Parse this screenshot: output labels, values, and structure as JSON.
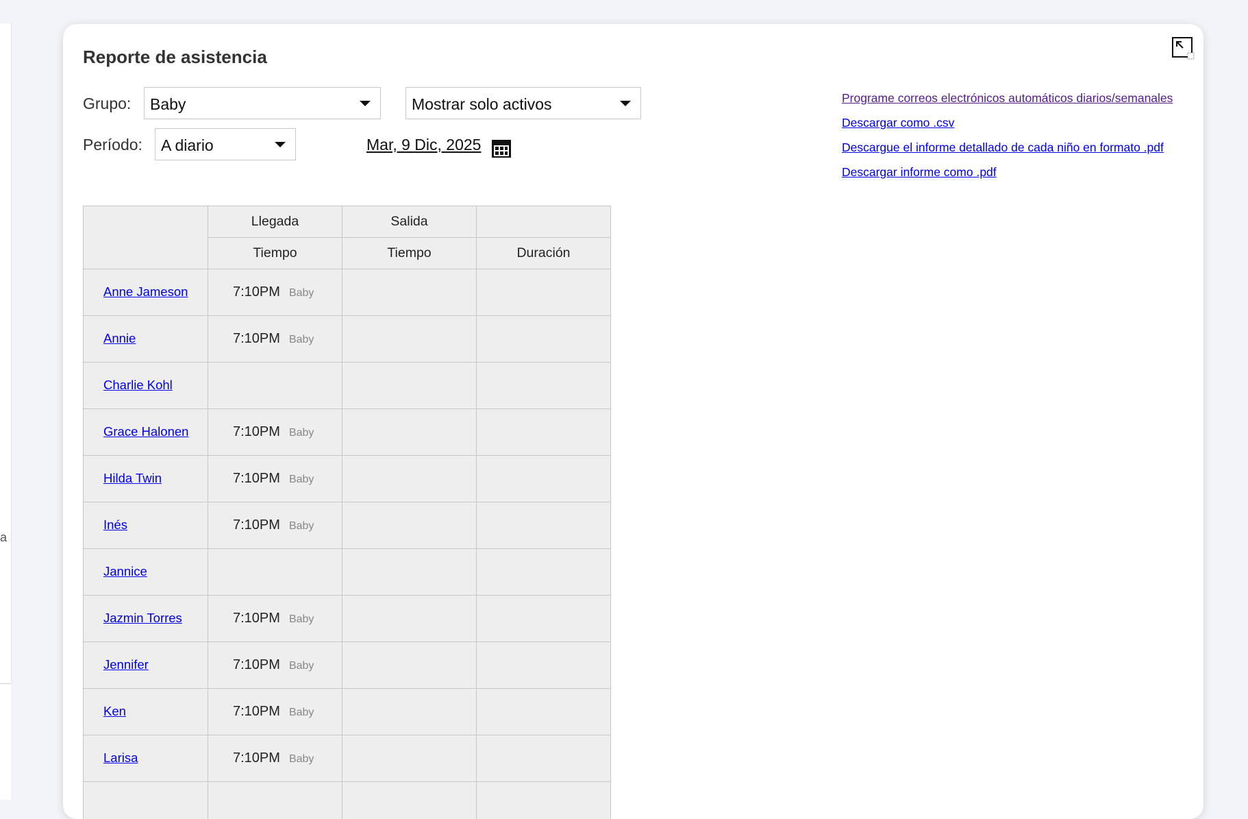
{
  "background": {
    "partial_text": "a"
  },
  "dialog": {
    "title": "Reporte de asistencia",
    "expand_icon": "expand-icon"
  },
  "filters": {
    "group_label": "Grupo:",
    "group_value": "Baby",
    "status_value": "Mostrar solo activos",
    "period_label": "Período:",
    "period_value": "A diario",
    "date": "Mar, 9 Dic, 2025",
    "calendar_icon": "calendar-icon"
  },
  "links": {
    "schedule_emails": "Programe correos electrónicos automáticos diarios/semanales",
    "download_csv": "Descargar como .csv",
    "download_detailed_pdf": "Descargue el informe detallado de cada niño en formato .pdf",
    "download_pdf": "Descargar informe como .pdf"
  },
  "table": {
    "arrival_header": "Llegada",
    "departure_header": "Salida",
    "time_header": "Tiempo",
    "duration_header": "Duración",
    "rows": [
      {
        "name": "Anne Jameson",
        "arrival_time": "7:10PM",
        "arrival_group": "Baby"
      },
      {
        "name": "Annie",
        "arrival_time": "7:10PM",
        "arrival_group": "Baby"
      },
      {
        "name": "Charlie Kohl",
        "arrival_time": "",
        "arrival_group": ""
      },
      {
        "name": "Grace Halonen",
        "arrival_time": "7:10PM",
        "arrival_group": "Baby"
      },
      {
        "name": "Hilda Twin",
        "arrival_time": "7:10PM",
        "arrival_group": "Baby"
      },
      {
        "name": "Inés",
        "arrival_time": "7:10PM",
        "arrival_group": "Baby"
      },
      {
        "name": "Jannice",
        "arrival_time": "",
        "arrival_group": ""
      },
      {
        "name": "Jazmin Torres",
        "arrival_time": "7:10PM",
        "arrival_group": "Baby"
      },
      {
        "name": "Jennifer",
        "arrival_time": "7:10PM",
        "arrival_group": "Baby"
      },
      {
        "name": "Ken",
        "arrival_time": "7:10PM",
        "arrival_group": "Baby"
      },
      {
        "name": "Larisa",
        "arrival_time": "7:10PM",
        "arrival_group": "Baby"
      },
      {
        "name": "",
        "arrival_time": "",
        "arrival_group": ""
      }
    ]
  },
  "colors": {
    "link": "#0000ee",
    "visited_link": "#551a8b",
    "table_bg": "#eeeeee",
    "page_bg": "#f3f4f8"
  }
}
